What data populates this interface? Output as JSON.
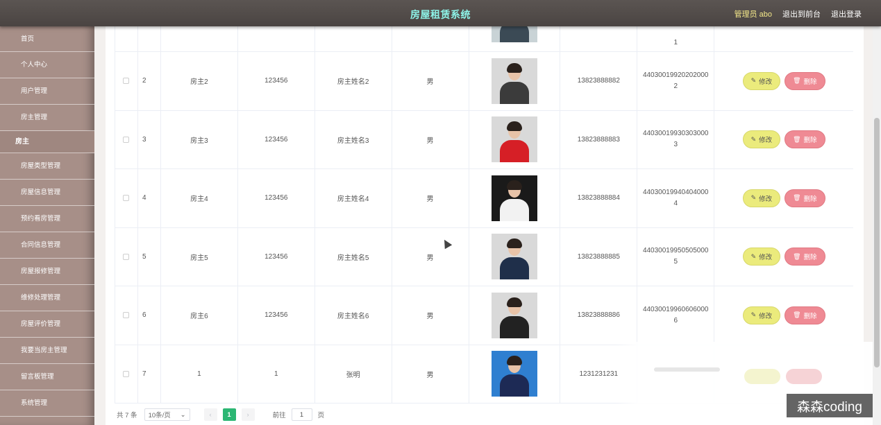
{
  "header": {
    "title": "房屋租赁系统",
    "admin_label": "管理员 abo",
    "front_link": "退出到前台",
    "logout_link": "退出登录"
  },
  "sidebar": {
    "items_top": [
      "首页",
      "个人中心",
      "用户管理",
      "房主管理"
    ],
    "group_label": "房主",
    "items_bottom": [
      "房屋类型管理",
      "房屋信息管理",
      "预约看房管理",
      "合同信息管理",
      "房屋报修管理",
      "维修处理管理",
      "房屋评价管理",
      "我要当房主管理",
      "留言板管理",
      "系统管理"
    ]
  },
  "table": {
    "partial_row": {
      "id_tail": "1"
    },
    "rows": [
      {
        "idx": "2",
        "account": "房主2",
        "password": "123456",
        "name": "房主姓名2",
        "sex": "男",
        "phone": "13823888882",
        "idcard": "440300199202020002"
      },
      {
        "idx": "3",
        "account": "房主3",
        "password": "123456",
        "name": "房主姓名3",
        "sex": "男",
        "phone": "13823888883",
        "idcard": "440300199303030003"
      },
      {
        "idx": "4",
        "account": "房主4",
        "password": "123456",
        "name": "房主姓名4",
        "sex": "男",
        "phone": "13823888884",
        "idcard": "440300199404040004"
      },
      {
        "idx": "5",
        "account": "房主5",
        "password": "123456",
        "name": "房主姓名5",
        "sex": "男",
        "phone": "13823888885",
        "idcard": "440300199505050005"
      },
      {
        "idx": "6",
        "account": "房主6",
        "password": "123456",
        "name": "房主姓名6",
        "sex": "男",
        "phone": "13823888886",
        "idcard": "440300199606060006"
      },
      {
        "idx": "7",
        "account": "1",
        "password": "1",
        "name": "张明",
        "sex": "男",
        "phone": "1231231231",
        "idcard": ""
      }
    ],
    "edit_label": "修改",
    "delete_label": "删除",
    "photo_colors": [
      "#3b3b3b",
      "#d61f26",
      "#f2f2f2",
      "#1f2f4a",
      "#222222",
      "#1d2a55"
    ]
  },
  "pagination": {
    "total": "共 7 条",
    "page_size": "10条/页",
    "current_page": "1",
    "goto_label": "前往",
    "goto_value": "1",
    "page_suffix": "页"
  },
  "watermark": "森森coding"
}
